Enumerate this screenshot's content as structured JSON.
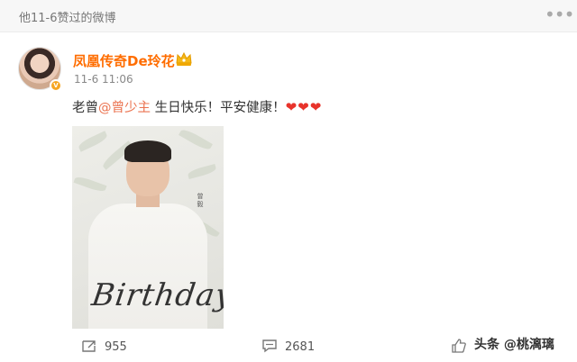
{
  "header": {
    "liked_label": "他11-6赞过的微博",
    "more_icon": "more-horizontal-icon"
  },
  "post": {
    "author": "凤凰传奇De玲花",
    "time": "11-6 11:06",
    "text_prefix": "老曾",
    "mention": "@曾少主",
    "text_suffix": " 生日快乐！平安健康！",
    "hearts": "❤❤❤",
    "image": {
      "vertical_name": "曾毅",
      "script_text": "Birthday"
    }
  },
  "actions": {
    "repost_count": "955",
    "comment_count": "2681"
  },
  "watermark": "头条 @桃漓璃",
  "colors": {
    "username": "#ff6d00",
    "mention": "#eb7350",
    "heart": "#e8332b"
  }
}
